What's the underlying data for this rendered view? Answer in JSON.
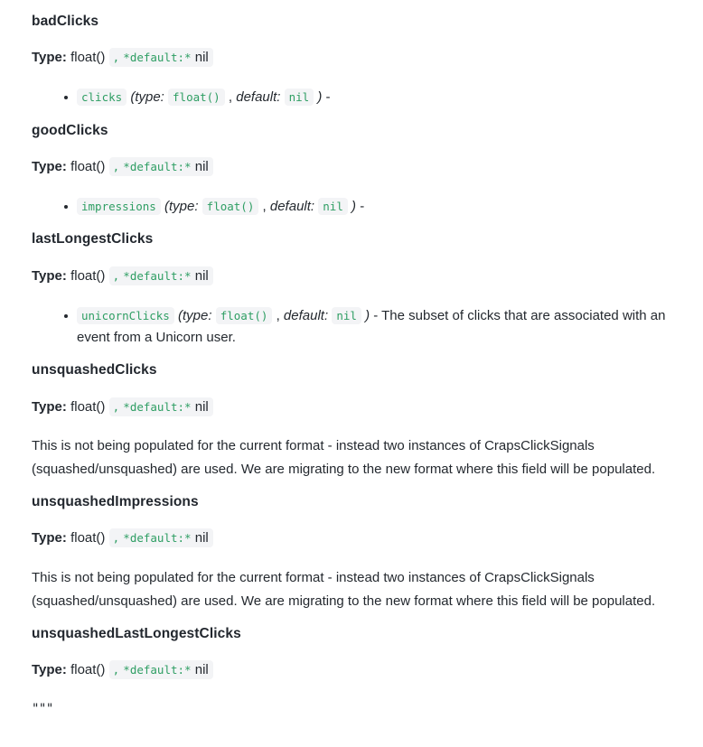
{
  "labels": {
    "type_label": "Type:",
    "type_value": "float()",
    "comma": ",",
    "default_marker": "*default:*",
    "nil_value": "nil",
    "type_kw": "type:",
    "default_kw": "default:",
    "open_paren": "(",
    "close_paren": ")",
    "dash": "-",
    "code_float": "float()",
    "code_nil": "nil"
  },
  "colors": {
    "code_green": "#2e9e63",
    "code_bg": "#f3f4f6",
    "text": "#24292f",
    "heading": "#22272e"
  },
  "fields": [
    {
      "name": "badClicks",
      "params": [
        {
          "name": "clicks",
          "type": "float()",
          "default": "nil",
          "description": ""
        }
      ],
      "notes": []
    },
    {
      "name": "goodClicks",
      "params": [
        {
          "name": "impressions",
          "type": "float()",
          "default": "nil",
          "description": ""
        }
      ],
      "notes": []
    },
    {
      "name": "lastLongestClicks",
      "params": [
        {
          "name": "unicornClicks",
          "type": "float()",
          "default": "nil",
          "description": "The subset of clicks that are associated with an event from a Unicorn user."
        }
      ],
      "notes": []
    },
    {
      "name": "unsquashedClicks",
      "params": [],
      "notes": [
        "This is not being populated for the current format - instead two instances of CrapsClickSignals (squashed/unsquashed) are used. We are migrating to the new format where this field will be populated."
      ]
    },
    {
      "name": "unsquashedImpressions",
      "params": [],
      "notes": [
        "This is not being populated for the current format - instead two instances of CrapsClickSignals (squashed/unsquashed) are used. We are migrating to the new format where this field will be populated."
      ]
    },
    {
      "name": "unsquashedLastLongestClicks",
      "params": [],
      "notes": []
    }
  ],
  "closing_quote": "\"\"\""
}
